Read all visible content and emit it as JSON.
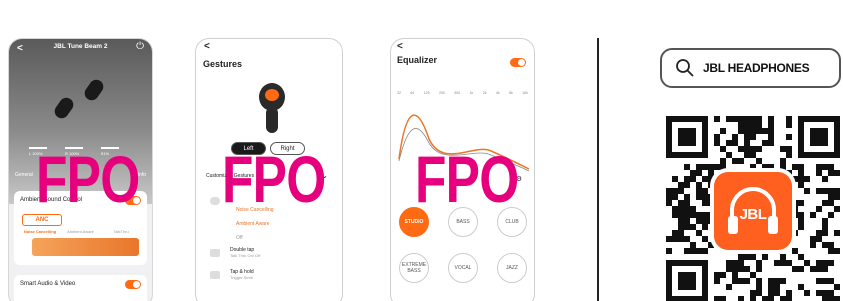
{
  "placeholder_label": "FPO",
  "phone_gestures": {
    "title": "Gestures",
    "back": "<",
    "left_label": "Left",
    "right_label": "Right",
    "customized_label": "Customized Gestures",
    "options": [
      "Noise Cancelling",
      "Ambient Aware",
      "Off"
    ],
    "double_tap": "Double tap",
    "double_tap_sub": "Talk Thru On/ Off",
    "tap_hold": "Tap & hold",
    "tap_hold_sub": "Trigger Smth"
  },
  "phone_device": {
    "title": "JBL Tune Beam 2",
    "back": "<",
    "power_icon": "power-icon",
    "battery": [
      "L 100%",
      "R 100%",
      "51%"
    ],
    "tabs": [
      "General",
      "",
      "Info"
    ],
    "ambient_title": "Ambient Sound Control",
    "anc_label": "ANC",
    "anc_options": [
      "Noise Cancelling",
      "Ambient Aware",
      "TalkThru"
    ],
    "smart_audio": "Smart Audio & Video"
  },
  "phone_eq": {
    "title": "Equalizer",
    "back": "<",
    "freqs": [
      "32",
      "64",
      "125",
      "250",
      "500",
      "1k",
      "2k",
      "4k",
      "8k",
      "16k"
    ],
    "presets": [
      "STUDIO",
      "BASS",
      "CLUB",
      "EXTREME BASS",
      "VOCAL",
      "JAZZ"
    ],
    "accent": "#ff6a13"
  },
  "search": {
    "text": "JBL HEADPHONES",
    "icon": "search-icon"
  },
  "qr": {
    "logo_text": "JBL",
    "logo_color": "#ff5f1f"
  }
}
